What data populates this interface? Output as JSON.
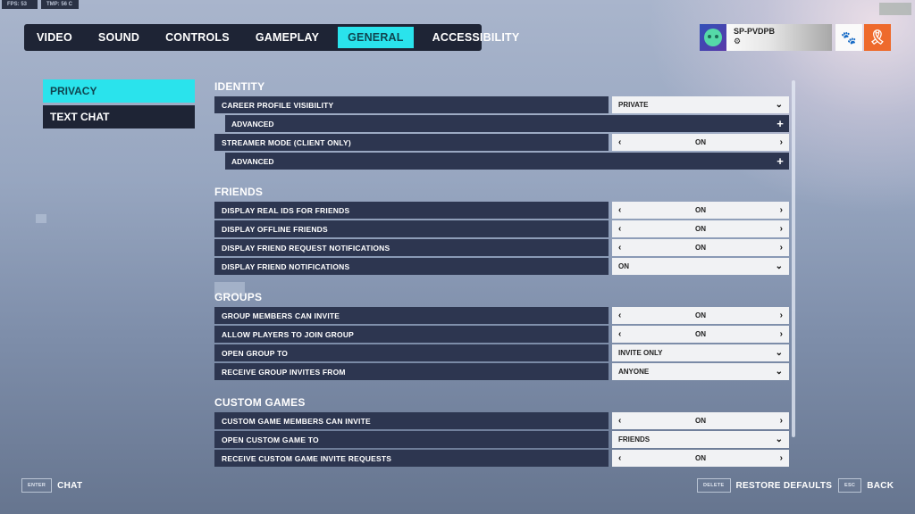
{
  "stats": {
    "fps": "FPS: 53",
    "tmp": "TMP: 56 C"
  },
  "tabs": [
    {
      "label": "VIDEO",
      "active": false
    },
    {
      "label": "SOUND",
      "active": false
    },
    {
      "label": "CONTROLS",
      "active": false
    },
    {
      "label": "GAMEPLAY",
      "active": false
    },
    {
      "label": "GENERAL",
      "active": true
    },
    {
      "label": "ACCESSIBILITY",
      "active": false
    }
  ],
  "profile": {
    "player_name": "SP-PVDPB",
    "platform_icon": "steam-icon",
    "social_icon": "paw-icon",
    "reward_icon": "medal-icon"
  },
  "sidebar": {
    "items": [
      {
        "label": "PRIVACY",
        "active": true
      },
      {
        "label": "TEXT CHAT",
        "active": false
      }
    ]
  },
  "sections": {
    "identity": {
      "title": "IDENTITY",
      "career_profile_visibility": {
        "label": "CAREER PROFILE VISIBILITY",
        "value": "PRIVATE"
      },
      "advanced_1": "ADVANCED",
      "streamer_mode": {
        "label": "STREAMER MODE (CLIENT ONLY)",
        "value": "ON"
      },
      "advanced_2": "ADVANCED"
    },
    "friends": {
      "title": "FRIENDS",
      "rows": [
        {
          "label": "DISPLAY REAL IDS FOR FRIENDS",
          "value": "ON"
        },
        {
          "label": "DISPLAY OFFLINE FRIENDS",
          "value": "ON"
        },
        {
          "label": "DISPLAY FRIEND REQUEST NOTIFICATIONS",
          "value": "ON"
        },
        {
          "label": "DISPLAY FRIEND NOTIFICATIONS",
          "value": "ON"
        }
      ]
    },
    "groups": {
      "title": "GROUPS",
      "rows": [
        {
          "label": "GROUP MEMBERS CAN INVITE",
          "value": "ON"
        },
        {
          "label": "ALLOW PLAYERS TO JOIN GROUP",
          "value": "ON"
        },
        {
          "label": "OPEN GROUP TO",
          "value": "INVITE ONLY"
        },
        {
          "label": "RECEIVE GROUP INVITES FROM",
          "value": "ANYONE"
        }
      ]
    },
    "custom_games": {
      "title": "CUSTOM GAMES",
      "rows": [
        {
          "label": "CUSTOM GAME MEMBERS CAN INVITE",
          "value": "ON"
        },
        {
          "label": "OPEN CUSTOM GAME TO",
          "value": "FRIENDS"
        },
        {
          "label": "RECEIVE CUSTOM GAME INVITE REQUESTS",
          "value": "ON"
        }
      ]
    }
  },
  "footer": {
    "chat": {
      "key": "ENTER",
      "label": "CHAT"
    },
    "restore": {
      "key": "DELETE",
      "label": "RESTORE DEFAULTS"
    },
    "back": {
      "key": "ESC",
      "label": "BACK"
    }
  },
  "colors": {
    "accent": "#2ae3ec",
    "panel": "#1e2435",
    "row": "#2d3650",
    "reward": "#ee6a2c"
  }
}
